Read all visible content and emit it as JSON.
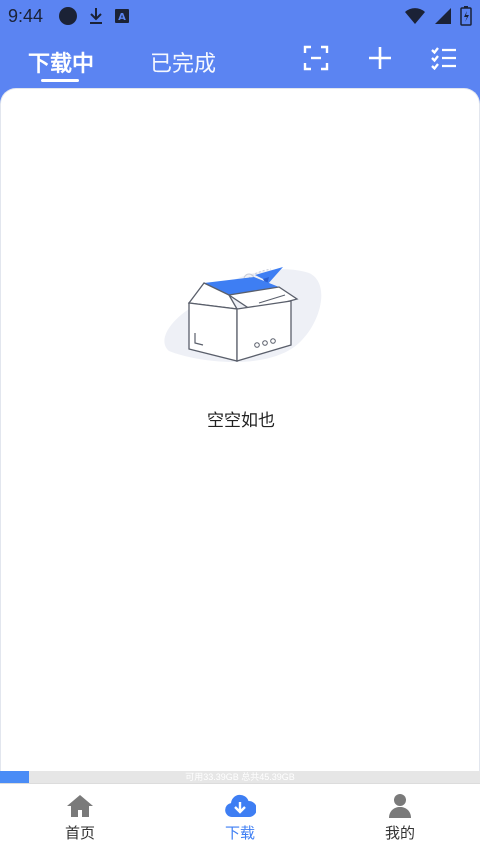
{
  "status_bar": {
    "time": "9:44",
    "left_icons": [
      "circle-icon",
      "download-icon",
      "a-badge-icon"
    ],
    "right_icons": [
      "wifi-icon",
      "signal-icon",
      "battery-icon"
    ]
  },
  "header": {
    "tabs": [
      {
        "label": "下载中",
        "active": true
      },
      {
        "label": "已完成",
        "active": false
      }
    ],
    "actions": [
      "scan-icon",
      "plus-icon",
      "checklist-icon"
    ]
  },
  "empty_state": {
    "text": "空空如也",
    "illustration": "open-box-paper-plane"
  },
  "storage": {
    "text": "可用33.39GB 总共45.39GB",
    "used_fraction": 0.06
  },
  "bottom_nav": {
    "items": [
      {
        "label": "首页",
        "icon": "home-icon",
        "active": false
      },
      {
        "label": "下载",
        "icon": "cloud-download-icon",
        "active": true
      },
      {
        "label": "我的",
        "icon": "user-icon",
        "active": false
      }
    ]
  },
  "colors": {
    "header": "#5b84f2",
    "accent": "#3e7ef3",
    "nav_inactive": "#7a7a7a"
  }
}
